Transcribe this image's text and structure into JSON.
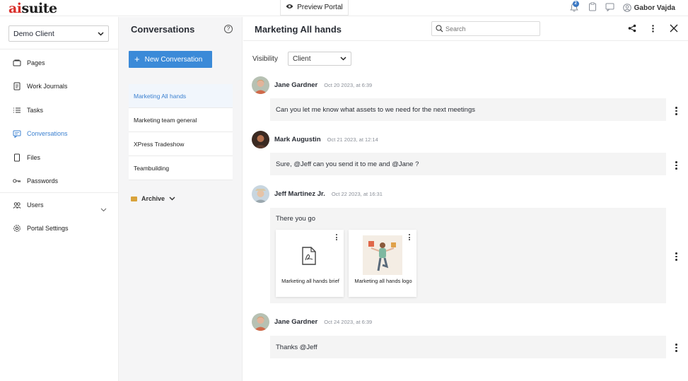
{
  "brand": {
    "logo_prefix": "ai",
    "logo_suffix": "suite",
    "accent": "#d9302c"
  },
  "topbar": {
    "preview_label": "Preview Portal",
    "notification_count": "2",
    "user_name": "Gabor Vajda"
  },
  "sidebar": {
    "client_select": "Demo Client",
    "items": [
      {
        "label": "Pages",
        "icon": "pages-icon"
      },
      {
        "label": "Work Journals",
        "icon": "journal-icon"
      },
      {
        "label": "Tasks",
        "icon": "tasks-icon"
      },
      {
        "label": "Conversations",
        "icon": "chat-icon",
        "active": true
      },
      {
        "label": "Files",
        "icon": "file-icon"
      },
      {
        "label": "Passwords",
        "icon": "key-icon"
      },
      {
        "label": "Users",
        "icon": "users-icon"
      },
      {
        "label": "Portal Settings",
        "icon": "gear-icon"
      }
    ]
  },
  "conversations": {
    "title": "Conversations",
    "new_label": "New Conversation",
    "items": [
      {
        "label": "Marketing All hands",
        "selected": true
      },
      {
        "label": "Marketing team general"
      },
      {
        "label": "XPress Tradeshow"
      },
      {
        "label": "Teambuilding"
      }
    ],
    "archive_label": "Archive"
  },
  "main": {
    "title": "Marketing All hands",
    "search_placeholder": "Search",
    "visibility_label": "Visibility",
    "visibility_value": "Client",
    "messages": [
      {
        "author": "Jane Gardner",
        "time": "Oct 20 2023, at 6:39",
        "text": "Can you let me know what assets to we need for the next meetings"
      },
      {
        "author": "Mark Augustin",
        "time": "Oct 21 2023, at 12:14",
        "text": "Sure, @Jeff can you send it to me and @Jane ?"
      },
      {
        "author": "Jeff Martinez Jr.",
        "time": "Oct 22 2023, at 16:31",
        "text": "There you go",
        "attachments": [
          {
            "name": "Marketing all hands brief",
            "icon": "pdf-icon"
          },
          {
            "name": "Marketing all hands logo",
            "icon": "image-thumbnail"
          }
        ]
      },
      {
        "author": "Jane Gardner",
        "time": "Oct 24 2023, at 6:39",
        "text": "Thanks @Jeff"
      }
    ]
  },
  "colors": {
    "primary": "#3b8ad8",
    "active_nav": "#3b80d0",
    "bubble_bg": "#f4f4f4"
  }
}
